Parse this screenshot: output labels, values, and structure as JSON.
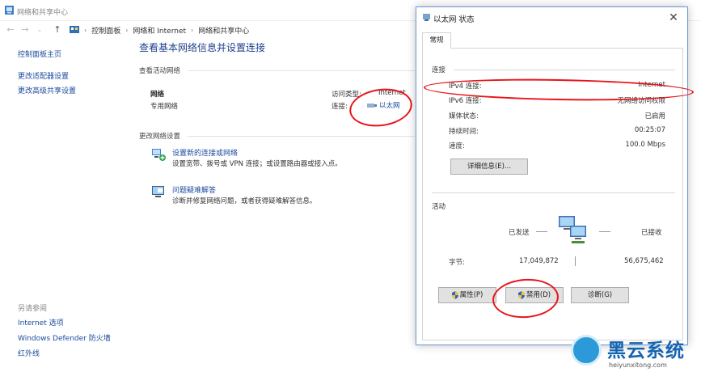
{
  "cp": {
    "title": "网络和共享中心",
    "breadcrumb": [
      "控制面板",
      "网络和 Internet",
      "网络和共享中心"
    ],
    "left_links": [
      "控制面板主页",
      "更改适配器设置",
      "更改高级共享设置"
    ],
    "see_also": {
      "header": "另请参阅",
      "links": [
        "Internet 选项",
        "Windows Defender 防火墙",
        "红外线"
      ]
    },
    "page_title": "查看基本网络信息并设置连接",
    "active_header": "查看活动网络",
    "network_name": "网络",
    "network_type": "专用网络",
    "access_type_label": "访问类型:",
    "access_type_value": "Internet",
    "connections_label": "连接:",
    "connection_link": "以太网",
    "change_header": "更改网络设置",
    "tasks": [
      {
        "link": "设置新的连接或网络",
        "desc": "设置宽带、拨号或 VPN 连接；或设置路由器或接入点。"
      },
      {
        "link": "问题疑难解答",
        "desc": "诊断并修复网络问题，或者获得疑难解答信息。"
      }
    ]
  },
  "dialog": {
    "title": "以太网 状态",
    "tab": "常规",
    "connection_header": "连接",
    "rows": [
      {
        "label": "IPv4 连接:",
        "value": "Internet"
      },
      {
        "label": "IPv6 连接:",
        "value": "无网络访问权限"
      },
      {
        "label": "媒体状态:",
        "value": "已启用"
      },
      {
        "label": "持续时间:",
        "value": "00:25:07"
      },
      {
        "label": "速度:",
        "value": "100.0 Mbps"
      }
    ],
    "details_button": "详细信息(E)...",
    "activity_header": "活动",
    "sent_label": "已发送",
    "received_label": "已接收",
    "bytes_label": "字节:",
    "bytes_sent": "17,049,872",
    "bytes_received": "56,675,462",
    "buttons": [
      "属性(P)",
      "禁用(D)",
      "诊断(G)"
    ]
  },
  "watermark": {
    "brand": "黑云系统",
    "site": "heiyunxitong.com"
  },
  "colors": {
    "link": "#1a4a9e",
    "title_blue": "#1e3f8c",
    "annotation_red": "#e8141a",
    "dialog_border": "#6a99d6"
  }
}
